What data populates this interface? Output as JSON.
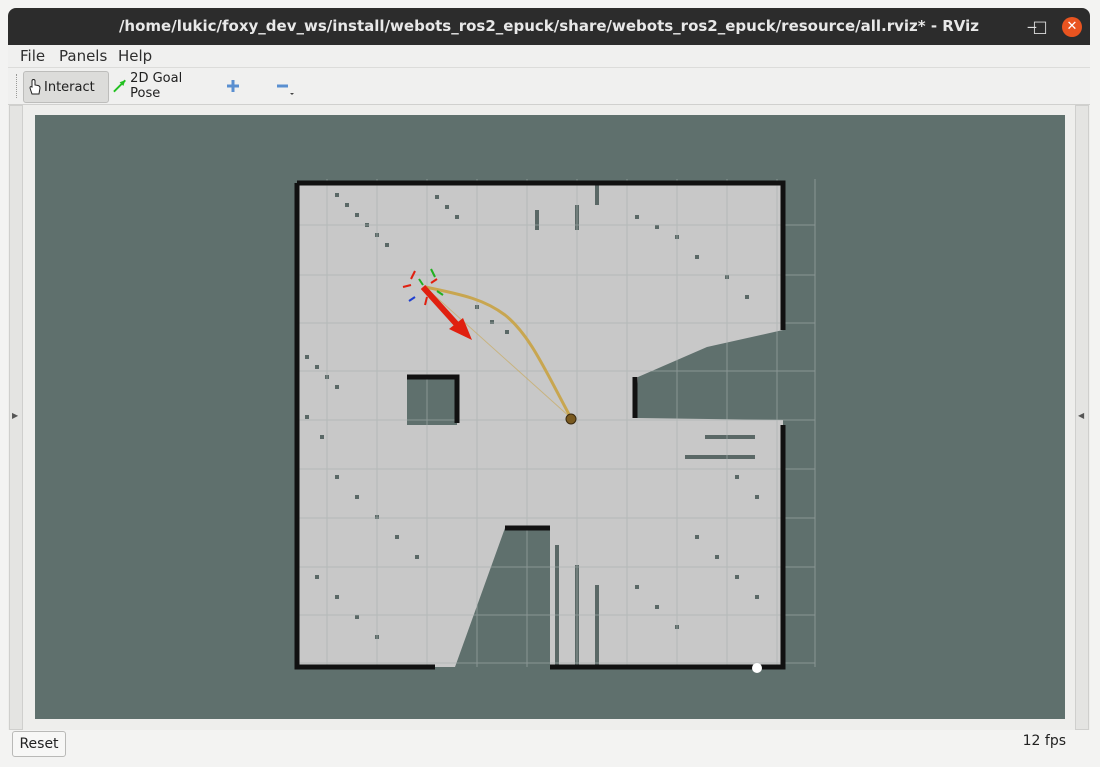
{
  "window": {
    "title": "/home/lukic/foxy_dev_ws/install/webots_ros2_epuck/share/webots_ros2_epuck/resource/all.rviz* - RViz",
    "controls": {
      "minimize": "‒",
      "maximize": "□",
      "close": "✕"
    }
  },
  "menubar": {
    "items": [
      {
        "label": "File"
      },
      {
        "label": "Panels"
      },
      {
        "label": "Help"
      }
    ]
  },
  "toolbar": {
    "interact_label": "Interact",
    "goal_pose_label": "2D Goal Pose",
    "add_tool_icon": "plus-icon",
    "remove_tool_icon": "minus-icon"
  },
  "status": {
    "reset_label": "Reset",
    "fps": "12 fps"
  },
  "colors": {
    "background": "#5f706d",
    "map_free": "#c8c8c8",
    "map_unknown": "#5f706d",
    "map_wall": "#111111",
    "grid": "#a8b0ae",
    "path": "#c8a650",
    "goal_arrow": "#e02010"
  },
  "icons": {
    "interact": "hand-cursor-icon",
    "goal_pose": "green-arrow-icon"
  }
}
